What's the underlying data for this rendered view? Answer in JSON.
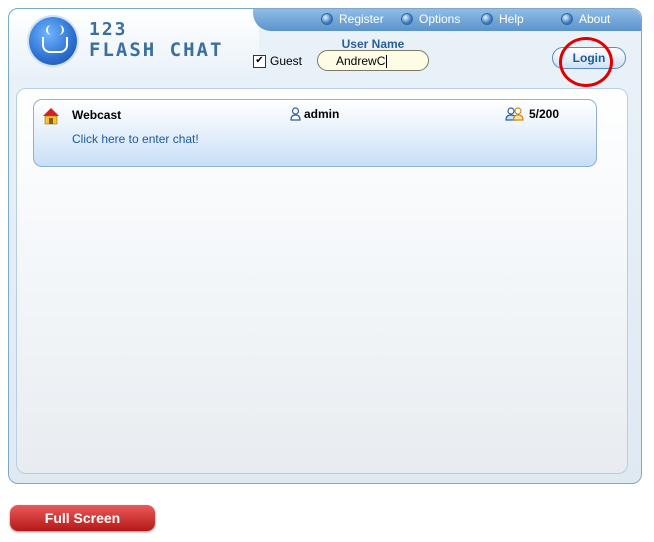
{
  "logo": {
    "line1": "123",
    "line2": "FLASH CHAT"
  },
  "nav": [
    {
      "label": "Register",
      "icon": "register-icon"
    },
    {
      "label": "Options",
      "icon": "options-icon"
    },
    {
      "label": "Help",
      "icon": "help-icon"
    },
    {
      "label": "About",
      "icon": "about-icon"
    }
  ],
  "login_form": {
    "guest_label": "Guest",
    "guest_checked": true,
    "username_label": "User Name",
    "username_value": "AndrewC",
    "login_label": "Login"
  },
  "rooms": [
    {
      "name": "Webcast",
      "owner": "admin",
      "users": "5/200",
      "enter_text": "Click here to enter chat!"
    }
  ],
  "fullscreen_label": "Full Screen",
  "colors": {
    "accent": "#5b93cc",
    "highlight_circle": "#e00000",
    "fullscreen": "#c62020"
  }
}
